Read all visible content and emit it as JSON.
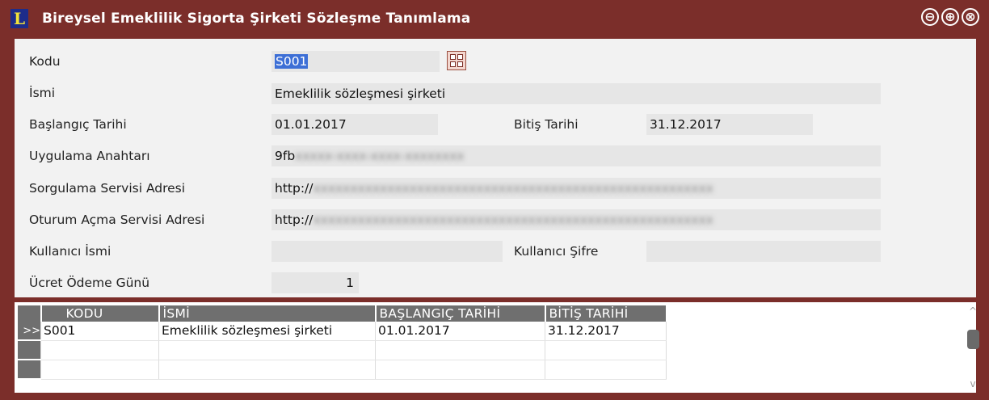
{
  "window": {
    "app_icon_glyph": "L",
    "title": "Bireysel Emeklilik Sigorta Şirketi Sözleşme Tanımlama",
    "minimize": "⊖",
    "maximize": "⊕",
    "close": "⊗"
  },
  "form": {
    "kodu_label": "Kodu",
    "kodu_value": "S001",
    "isim_label": "İsmi",
    "isim_value": "Emeklilik sözleşmesi şirketi",
    "baslangic_label": "Başlangıç Tarihi",
    "baslangic_value": "01.01.2017",
    "bitis_label": "Bitiş Tarihi",
    "bitis_value": "31.12.2017",
    "anahtar_label": "Uygulama Anahtarı",
    "anahtar_value": "9fb",
    "sorgulama_label": "Sorgulama Servisi Adresi",
    "sorgulama_value": "http://",
    "oturum_label": "Oturum Açma Servisi Adresi",
    "oturum_value": "http://",
    "kullanici_label": "Kullanıcı İsmi",
    "kullanici_value": "",
    "sifre_label": "Kullanıcı Şifre",
    "sifre_value": "",
    "ucret_label": "Ücret Ödeme Günü",
    "ucret_value": "1"
  },
  "grid": {
    "columns": [
      "KODU",
      "İSMİ",
      "BAŞLANGIÇ TARİHİ",
      "BİTİŞ TARİHİ"
    ],
    "active_indicator": ">>",
    "rows": [
      {
        "kodu": "S001",
        "isim": "Emeklilik sözleşmesi şirketi",
        "baslangic": "01.01.2017",
        "bitis": "31.12.2017"
      }
    ]
  },
  "scrollbar": {
    "up": "^",
    "down": "v"
  },
  "colors": {
    "frame": "#7b2e2a",
    "selection": "#3d6fd6",
    "grid_header": "#6f6f6f"
  }
}
